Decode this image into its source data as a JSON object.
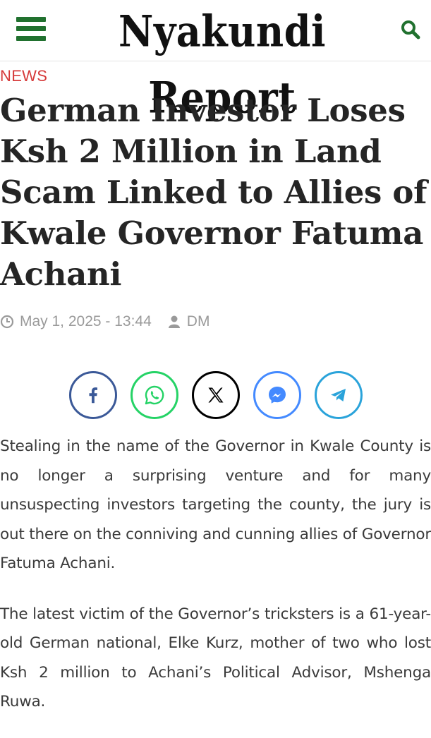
{
  "header": {
    "logo_text": "Nyakundi Report",
    "menu_icon": "hamburger-icon",
    "search_icon": "search-icon",
    "brand_color": "#21712f"
  },
  "article": {
    "category": "NEWS",
    "category_color": "#d63b3b",
    "title": "German Investor Loses Ksh 2 Million in Land Scam Linked to Allies of Kwale Governor Fatuma Achani",
    "date": "May 1, 2025 - 13:44",
    "author": "DM",
    "paragraphs": [
      "Stealing in the name of the Governor in Kwale County is no longer a surprising venture and for many unsuspecting investors targeting the county, the jury is out there on the conniving and cunning allies of Governor Fatuma Achani.",
      "The latest victim of the Governor’s tricksters is a 61-year-old German national, Elke Kurz, mother of two who lost Ksh 2 million to Achani’s Political Advisor, Mshenga Ruwa."
    ]
  },
  "share": [
    {
      "icon": "facebook-icon",
      "color": "#3b5998"
    },
    {
      "icon": "whatsapp-icon",
      "color": "#25d366"
    },
    {
      "icon": "x-icon",
      "color": "#000000"
    },
    {
      "icon": "messenger-icon",
      "color": "#448aff"
    },
    {
      "icon": "telegram-icon",
      "color": "#2aa3da"
    }
  ]
}
